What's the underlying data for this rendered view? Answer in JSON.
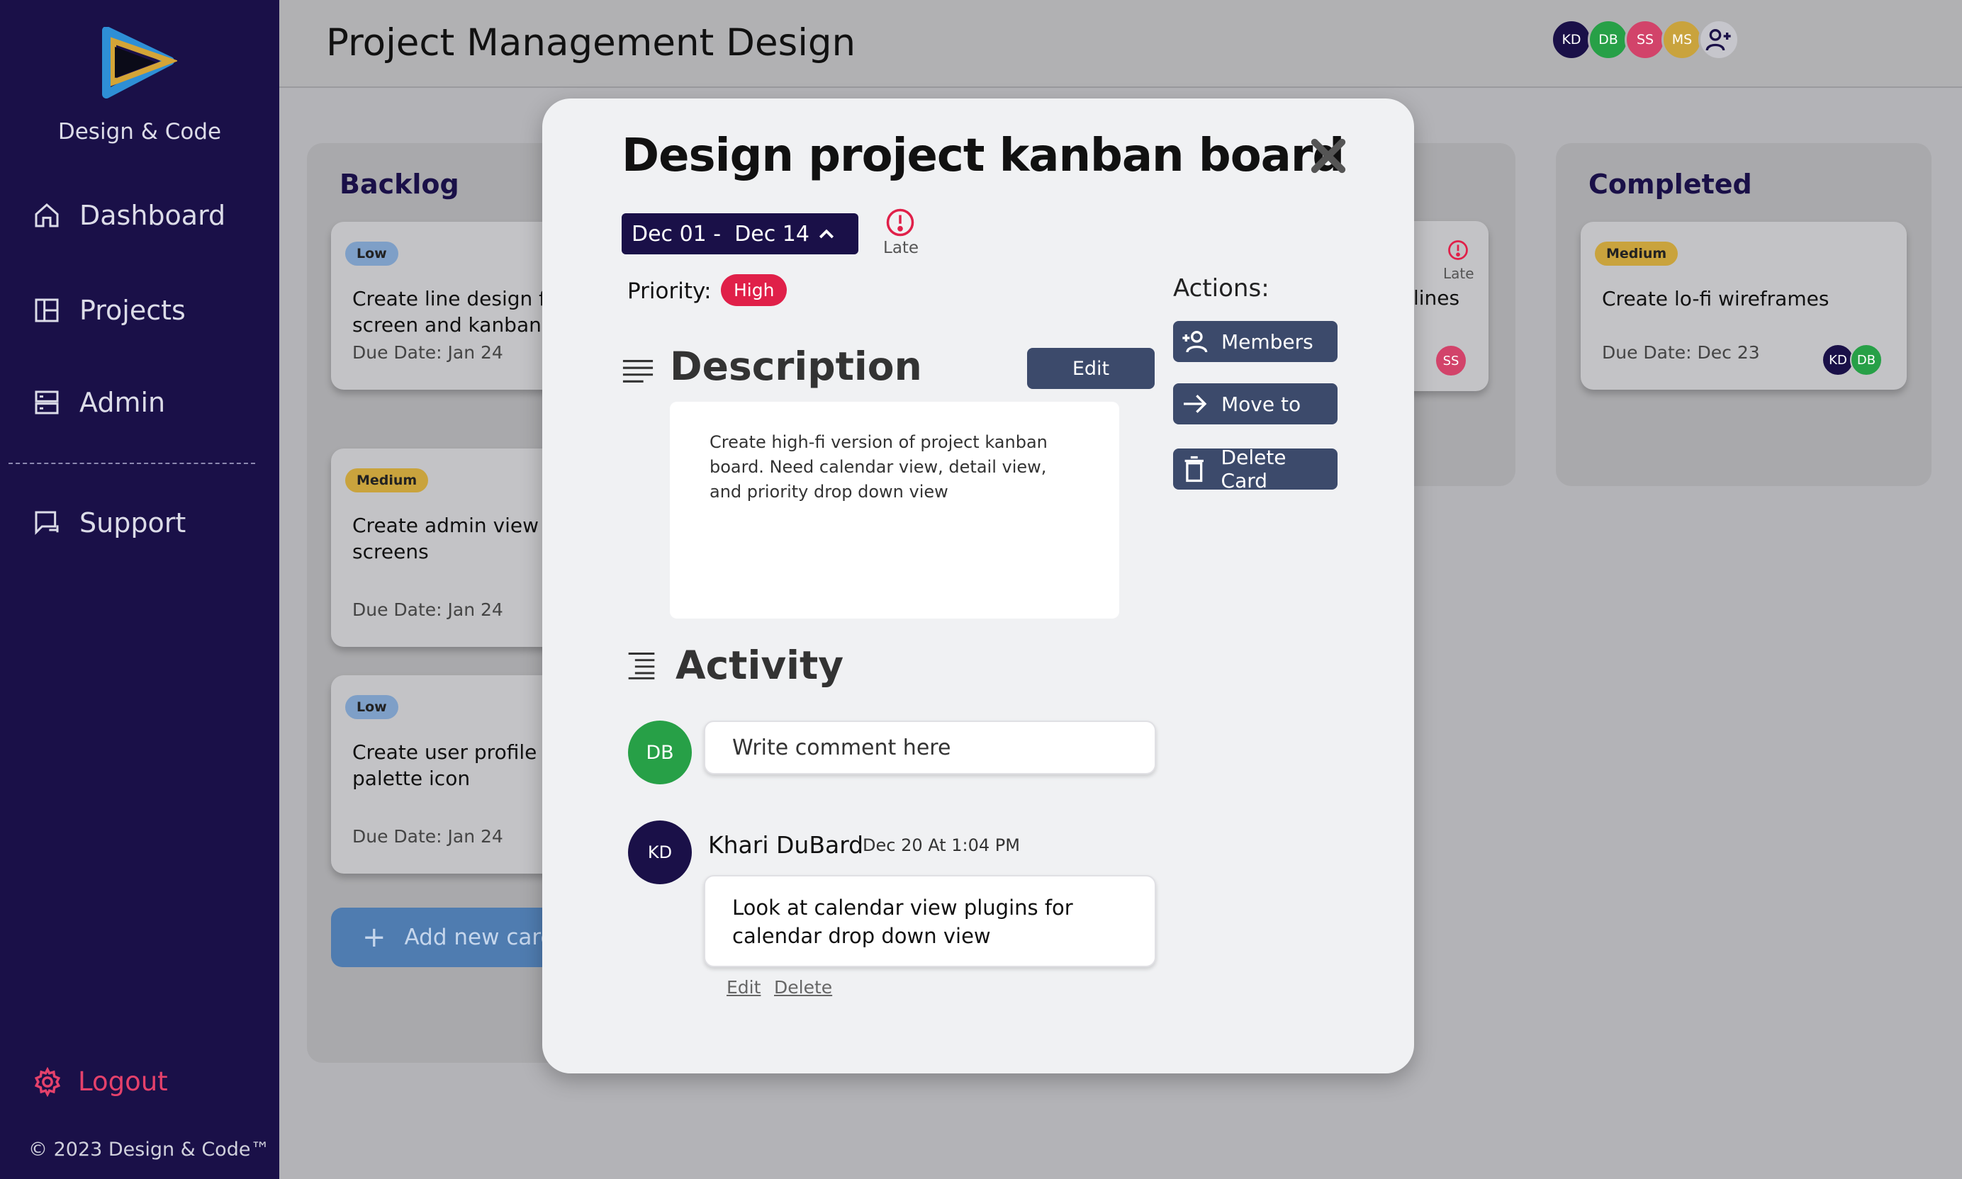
{
  "app": {
    "brand": "Design & Code",
    "copyright": "© 2023 Design & Code™",
    "colors": {
      "sidebar": "#1a1048",
      "accent_red": "#e02049",
      "button": "#3c4a6b"
    }
  },
  "sidebar": {
    "items": [
      {
        "label": "Dashboard",
        "icon": "home-icon"
      },
      {
        "label": "Projects",
        "icon": "layout-icon"
      },
      {
        "label": "Admin",
        "icon": "server-icon"
      },
      {
        "label": "Support",
        "icon": "support-chat-icon"
      }
    ],
    "logout_label": "Logout"
  },
  "header": {
    "title": "Project Management Design",
    "members": [
      {
        "initials": "KD",
        "color": "#1a1048"
      },
      {
        "initials": "DB",
        "color": "#27a047"
      },
      {
        "initials": "SS",
        "color": "#d2436a"
      },
      {
        "initials": "MS",
        "color": "#c9a33d"
      }
    ]
  },
  "board": {
    "backlog": {
      "title": "Backlog",
      "cards": [
        {
          "badge": "Low",
          "text_line1": "Create line design for",
          "text_line2": "screen and kanban bo",
          "due": "Due Date: Jan 24"
        },
        {
          "badge": "Medium",
          "text_line1": "Create admin view for",
          "text_line2": "screens",
          "due": "Due Date: Jan 24"
        },
        {
          "badge": "Low",
          "text_line1": "Create user profile co",
          "text_line2": "palette icon",
          "due": "Due Date: Jan 24"
        }
      ],
      "add_label": "Add new card"
    },
    "middle_peek": {
      "late": "Late",
      "text": "lines",
      "avatar": "SS"
    },
    "completed": {
      "title": "Completed",
      "cards": [
        {
          "badge": "Medium",
          "text": "Create lo-fi wireframes",
          "due": "Due Date: Dec 23",
          "avatars": [
            "KD",
            "DB"
          ]
        }
      ]
    }
  },
  "modal": {
    "title": "Design project kanban board",
    "date_range": "Dec 01 -  Dec 14",
    "late_label": "Late",
    "priority_label": "Priority:",
    "priority_value": "High",
    "description_title": "Description",
    "description_edit": "Edit",
    "description_text": "Create high-fi version of project kanban board. Need calendar view, detail view, and priority drop down view",
    "actions_label": "Actions:",
    "actions": [
      {
        "label": "Members",
        "icon": "add-member-icon"
      },
      {
        "label": "Move to",
        "icon": "arrow-right-icon"
      },
      {
        "label": "Delete Card",
        "icon": "trash-icon"
      }
    ],
    "activity_title": "Activity",
    "current_user": "DB",
    "comment_placeholder": "Write comment here",
    "comments": [
      {
        "avatar": "KD",
        "author": "Khari DuBard",
        "time": "Dec 20 At 1:04 PM",
        "text": "Look at calendar view plugins for calendar drop down view",
        "edit_label": "Edit",
        "delete_label": "Delete"
      }
    ]
  }
}
